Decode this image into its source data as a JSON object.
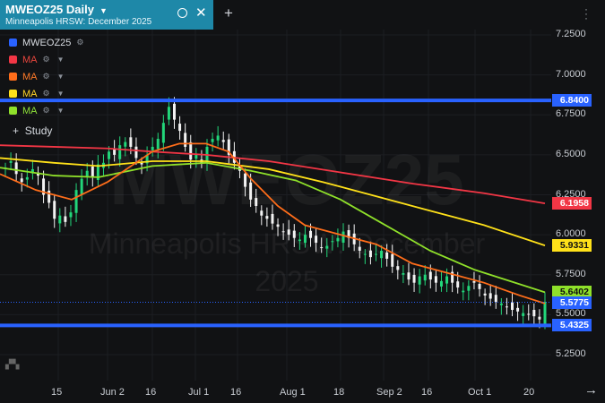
{
  "tab": {
    "title": "MWEOZ25 Daily",
    "subtitle": "Minneapolis HRSW: December 2025"
  },
  "legend": [
    {
      "label": "MWEOZ25",
      "color": "#2962ff",
      "text_color": "#d8dce2"
    },
    {
      "label": "MA",
      "color": "#f23645",
      "text_color": "#e8463d"
    },
    {
      "label": "MA",
      "color": "#ff6d1a",
      "text_color": "#ff7a28"
    },
    {
      "label": "MA",
      "color": "#ffe119",
      "text_color": "#ffd426"
    },
    {
      "label": "MA",
      "color": "#8fe02a",
      "text_color": "#8ee23a"
    }
  ],
  "study_label": "Study",
  "watermark": {
    "symbol": "MWEOZ25",
    "line1": "Minneapolis HRSW: December",
    "line2": "2025"
  },
  "y_axis": [
    "7.2500",
    "7.0000",
    "6.7500",
    "6.5000",
    "6.2500",
    "6.0000",
    "5.7500",
    "5.5000",
    "5.2500"
  ],
  "x_axis": [
    "15",
    "Jun 2",
    "16",
    "Jul 1",
    "16",
    "Aug 1",
    "18",
    "Sep 2",
    "16",
    "Oct 1",
    "20"
  ],
  "price_tags": [
    {
      "value": "6.8400",
      "color": "#2962ff"
    },
    {
      "value": "6.1958",
      "color": "#f23645"
    },
    {
      "value": "5.9331",
      "color": "#ffe119"
    },
    {
      "value": "5.6402",
      "color": "#8fe02a"
    },
    {
      "value": "5.5775",
      "color": "#2962ff"
    },
    {
      "value": "5.4325",
      "color": "#2962ff"
    }
  ],
  "horizontal_lines": [
    6.84,
    5.4325
  ],
  "chart_data": {
    "type": "candlestick",
    "symbol": "MWEOZ25",
    "y_range": [
      5.1,
      7.3
    ],
    "ohlc_close": [
      6.42,
      6.46,
      6.38,
      6.33,
      6.36,
      6.41,
      6.37,
      6.25,
      6.2,
      6.1,
      6.12,
      6.08,
      6.14,
      6.28,
      6.35,
      6.4,
      6.36,
      6.44,
      6.45,
      6.52,
      6.5,
      6.56,
      6.58,
      6.55,
      6.48,
      6.44,
      6.5,
      6.55,
      6.6,
      6.7,
      6.8,
      6.72,
      6.65,
      6.55,
      6.47,
      6.5,
      6.45,
      6.55,
      6.6,
      6.62,
      6.58,
      6.5,
      6.45,
      6.4,
      6.3,
      6.22,
      6.18,
      6.12,
      6.1,
      6.07,
      6.05,
      6.02,
      6.0,
      5.98,
      5.97,
      6.0,
      5.98,
      5.95,
      5.92,
      5.93,
      5.96,
      5.98,
      6.02,
      5.98,
      5.94,
      5.9,
      5.88,
      5.86,
      5.88,
      5.9,
      5.85,
      5.8,
      5.78,
      5.76,
      5.72,
      5.7,
      5.74,
      5.75,
      5.72,
      5.7,
      5.71,
      5.74,
      5.7,
      5.67,
      5.65,
      5.68,
      5.7,
      5.66,
      5.62,
      5.6,
      5.58,
      5.57,
      5.55,
      5.53,
      5.52,
      5.51,
      5.5,
      5.49,
      5.47,
      5.58
    ],
    "moving_averages": {
      "MA_red_end": 6.1958,
      "MA_yellow_end": 5.9331,
      "MA_green_end": 5.6402
    },
    "last_price": 5.5775
  }
}
